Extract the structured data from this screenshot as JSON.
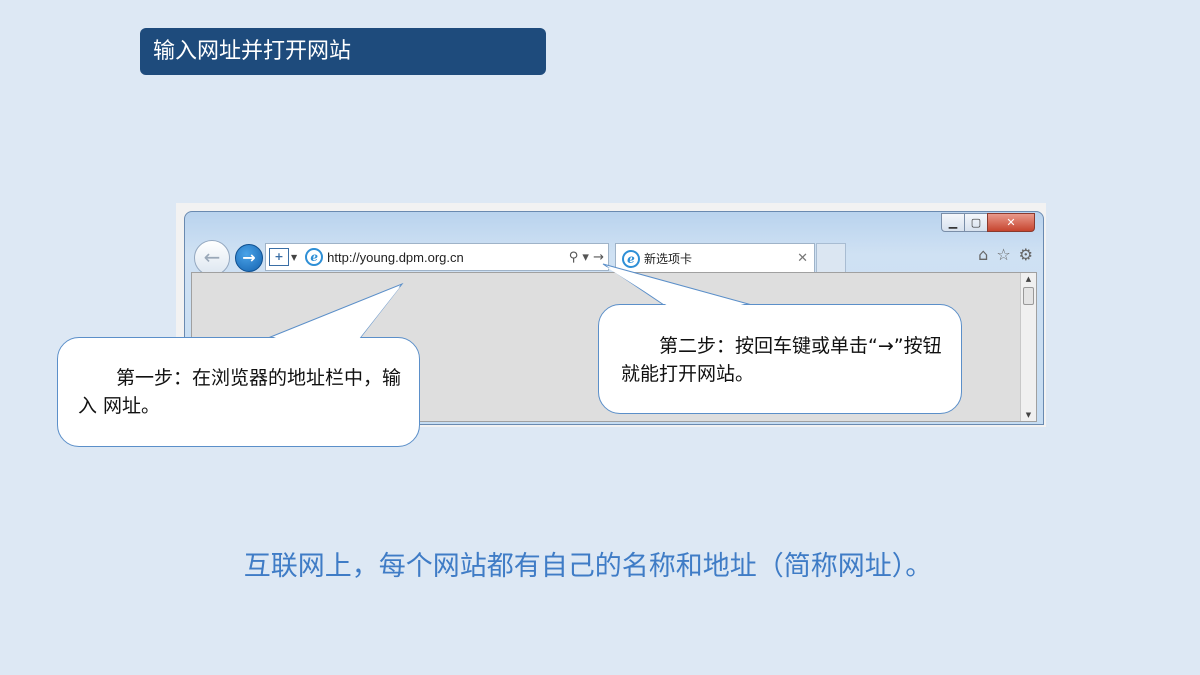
{
  "slide": {
    "title": "输入网址并打开网站",
    "bottom_text": "互联网上，每个网站都有自己的名称和地址（简称网址）。"
  },
  "browser": {
    "url": "http://young.dpm.org.cn",
    "tab_label": "新选项卡",
    "win_min": "▁",
    "win_max": "▢",
    "win_close": "✕",
    "back_glyph": "←",
    "forward_glyph": "→",
    "compat_glyph": "+",
    "ie_glyph": "e",
    "addr_tools": "⚲ ▾ →",
    "tab_close": "✕",
    "home_icon": "⌂",
    "fav_icon": "☆",
    "settings_icon": "⚙",
    "icons": [
      "back-arrow-icon",
      "forward-arrow-icon",
      "compatibility-view-icon",
      "ie-logo-icon",
      "search-icon",
      "go-arrow-icon",
      "home-icon",
      "favorites-star-icon",
      "gear-icon"
    ]
  },
  "callouts": {
    "step1": "第一步：在浏览器的地址栏中，输入 网址。",
    "step2": "第二步：按回车键或单击“→”按钮就能打开网站。"
  },
  "colors": {
    "background": "#dde8f4",
    "title_bar": "#1e4b7c",
    "bottom_text": "#3f7cc6",
    "callout_border": "#5b8fc9"
  }
}
